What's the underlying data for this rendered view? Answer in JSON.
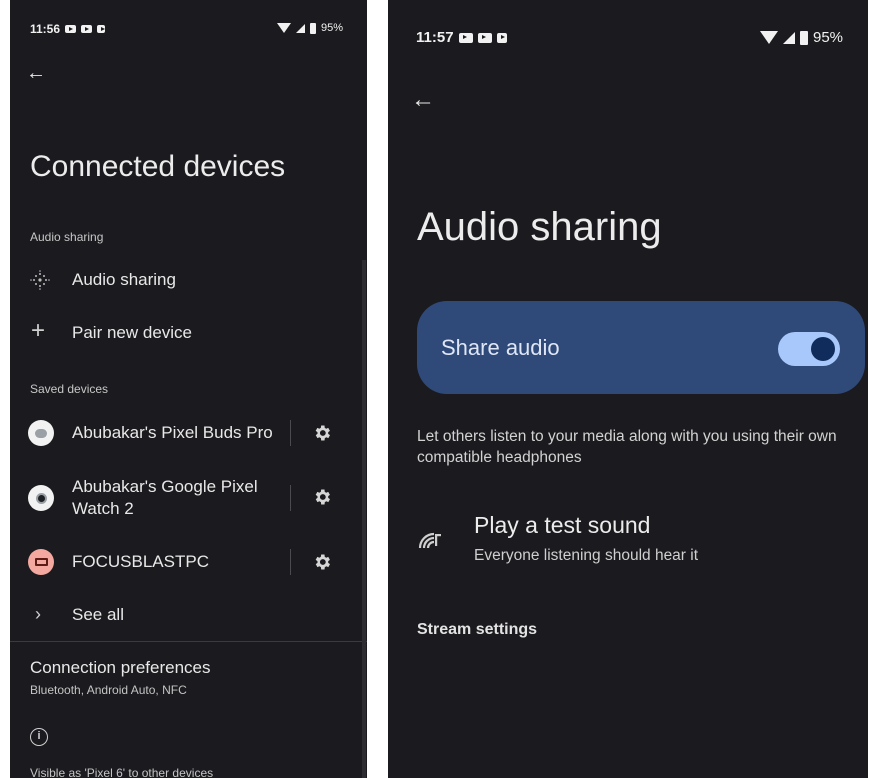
{
  "left_screen": {
    "status": {
      "time": "11:56",
      "battery": "95%"
    },
    "title": "Connected devices",
    "audio_section_label": "Audio sharing",
    "audio_sharing_item": "Audio sharing",
    "pair_item": "Pair new device",
    "saved_section_label": "Saved devices",
    "devices": [
      {
        "name": "Abubakar's Pixel Buds Pro"
      },
      {
        "name_line1": "Abubakar's Google Pixel",
        "name_line2": "Watch 2"
      },
      {
        "name": "FOCUSBLASTPC"
      }
    ],
    "see_all": "See all",
    "connection_prefs": {
      "title": "Connection preferences",
      "subtitle": "Bluetooth, Android Auto, NFC"
    },
    "visible_text": "Visible as 'Pixel 6' to other devices"
  },
  "right_screen": {
    "status": {
      "time": "11:57",
      "battery": "95%"
    },
    "title": "Audio sharing",
    "share_audio_label": "Share audio",
    "share_audio_on": true,
    "description": "Let others listen to your media along with you using their own compatible headphones",
    "test_sound": {
      "title": "Play a test sound",
      "subtitle": "Everyone listening should hear it"
    },
    "stream_settings": "Stream settings"
  },
  "colors": {
    "background": "#1b1b1f",
    "toggle_card": "#2f4a79",
    "switch_track": "#a8c7fa",
    "switch_knob": "#0f2c5c"
  }
}
